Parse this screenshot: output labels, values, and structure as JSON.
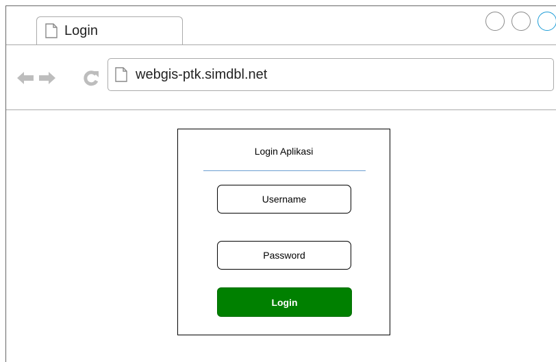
{
  "browser": {
    "tab": {
      "title": "Login",
      "icon": "document-icon"
    },
    "window_controls": [
      "circle",
      "circle",
      "circle-active"
    ],
    "nav": {
      "back_icon": "arrow-left-icon",
      "forward_icon": "arrow-right-icon",
      "refresh_icon": "refresh-icon"
    },
    "address": {
      "url": "webgis-ptk.simdbl.net",
      "icon": "document-icon"
    },
    "colors": {
      "border": "#a9a9a9",
      "active_control": "#1a9bd6"
    }
  },
  "login": {
    "title": "Login Aplikasi",
    "username_placeholder": "Username",
    "password_placeholder": "Password",
    "button_label": "Login",
    "colors": {
      "button": "#008000",
      "divider": "#6a9ed1"
    }
  }
}
